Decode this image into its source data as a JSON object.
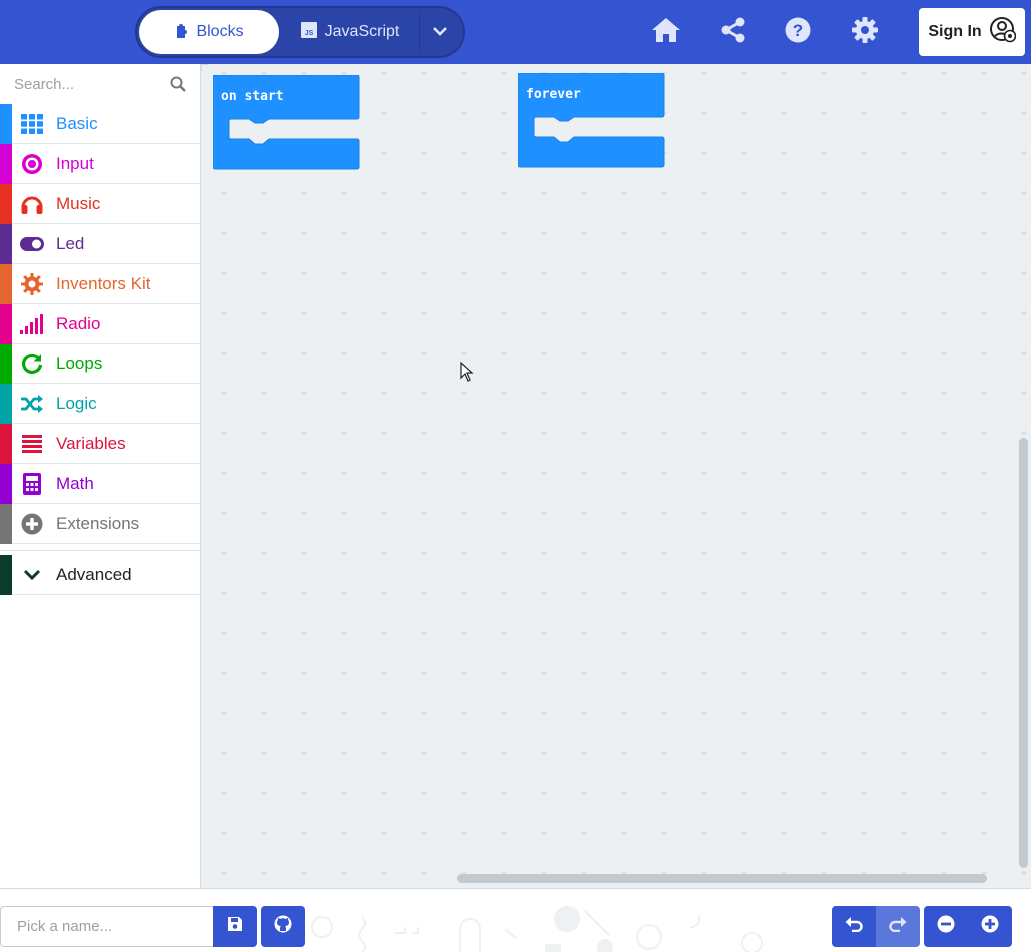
{
  "header": {
    "tabs": [
      {
        "label": "Blocks",
        "icon": "puzzle-icon",
        "active": true
      },
      {
        "label": "JavaScript",
        "icon": "js-file-icon",
        "active": false
      }
    ],
    "icons": [
      "home-icon",
      "share-icon",
      "help-icon",
      "gear-icon"
    ],
    "signin_label": "Sign In",
    "brand_color": "#3454d1"
  },
  "sidebar": {
    "search_placeholder": "Search...",
    "categories": [
      {
        "label": "Basic",
        "icon": "grid-icon",
        "color": "#1e90ff"
      },
      {
        "label": "Input",
        "icon": "radio-button-icon",
        "color": "#d400d4"
      },
      {
        "label": "Music",
        "icon": "headphones-icon",
        "color": "#e63022"
      },
      {
        "label": "Led",
        "icon": "toggle-icon",
        "color": "#5c2d91"
      },
      {
        "label": "Inventors Kit",
        "icon": "cog-icon",
        "color": "#e4652e"
      },
      {
        "label": "Radio",
        "icon": "signal-bars-icon",
        "color": "#e3008c"
      },
      {
        "label": "Loops",
        "icon": "refresh-icon",
        "color": "#00aa00"
      },
      {
        "label": "Logic",
        "icon": "shuffle-icon",
        "color": "#00a4a6"
      },
      {
        "label": "Variables",
        "icon": "list-icon",
        "color": "#dc143c"
      },
      {
        "label": "Math",
        "icon": "calculator-icon",
        "color": "#9400d3"
      },
      {
        "label": "Extensions",
        "icon": "plus-circle-icon",
        "color": "#757575"
      },
      {
        "label": "Advanced",
        "icon": "chevron-down-icon",
        "color": "#0b3c2a"
      }
    ]
  },
  "workspace": {
    "blocks": [
      {
        "label": "on start",
        "color": "#1e90ff"
      },
      {
        "label": "forever",
        "color": "#1e90ff"
      }
    ]
  },
  "bottombar": {
    "name_placeholder": "Pick a name..."
  }
}
